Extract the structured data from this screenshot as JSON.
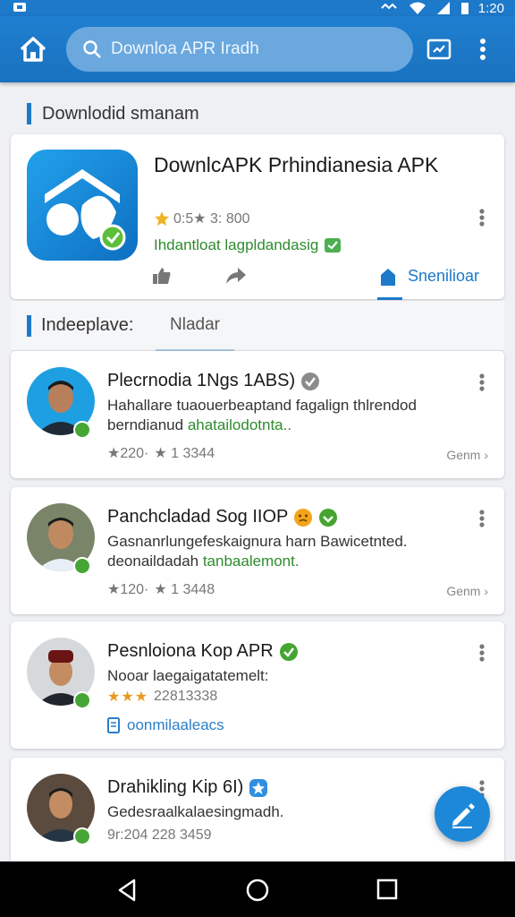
{
  "status": {
    "time": "1:20"
  },
  "search": {
    "placeholder": "Downloa APR Iradh"
  },
  "section": {
    "title": "Downlodid smanam"
  },
  "featured": {
    "title": "DownlcAPK Prhindianesia APK",
    "rating": "0:5★ 3: 800",
    "download": "Ihdantloat lagpldandasig"
  },
  "subscribe": {
    "label": "Snenilioar"
  },
  "tabs": {
    "label": "Indeeplave:",
    "active": "Nladar"
  },
  "items": [
    {
      "name": "Plecrnodia 1Ngs 1ABS)",
      "desc_1": "Hahallare tuaouerbeaptand fagalign thlrendod",
      "desc_2a": "berndianud ",
      "desc_2b": "ahatailodotnta..",
      "stats_1": "★220·",
      "stats_2": "★ 1 3344",
      "more": "Genm ›"
    },
    {
      "name": "Panchcladad Sog IIOP",
      "desc_1": "Gasnanrlungefeskaignura harn Bawicetnted.",
      "desc_2a": "deonaildadah ",
      "desc_2b": "tanbaalemont.",
      "stats_1": "★120·",
      "stats_2": "★ 1 3448",
      "more": "Genm ›"
    },
    {
      "name": "Pesnloiona Kop APR",
      "desc_1": "Nooar laegaigatatemelt:",
      "stars": "★★★",
      "stats_2": "22813338",
      "link": "oonmilaaleacs"
    },
    {
      "name": "Drahikling Kip 6I)",
      "desc_1": "Gedesraalkalaesingmadh.",
      "stats_2": "9r:204 228 3459"
    }
  ],
  "colors": {
    "primary": "#1d79c9",
    "green": "#2e8b2e",
    "star": "#e89a1d"
  }
}
